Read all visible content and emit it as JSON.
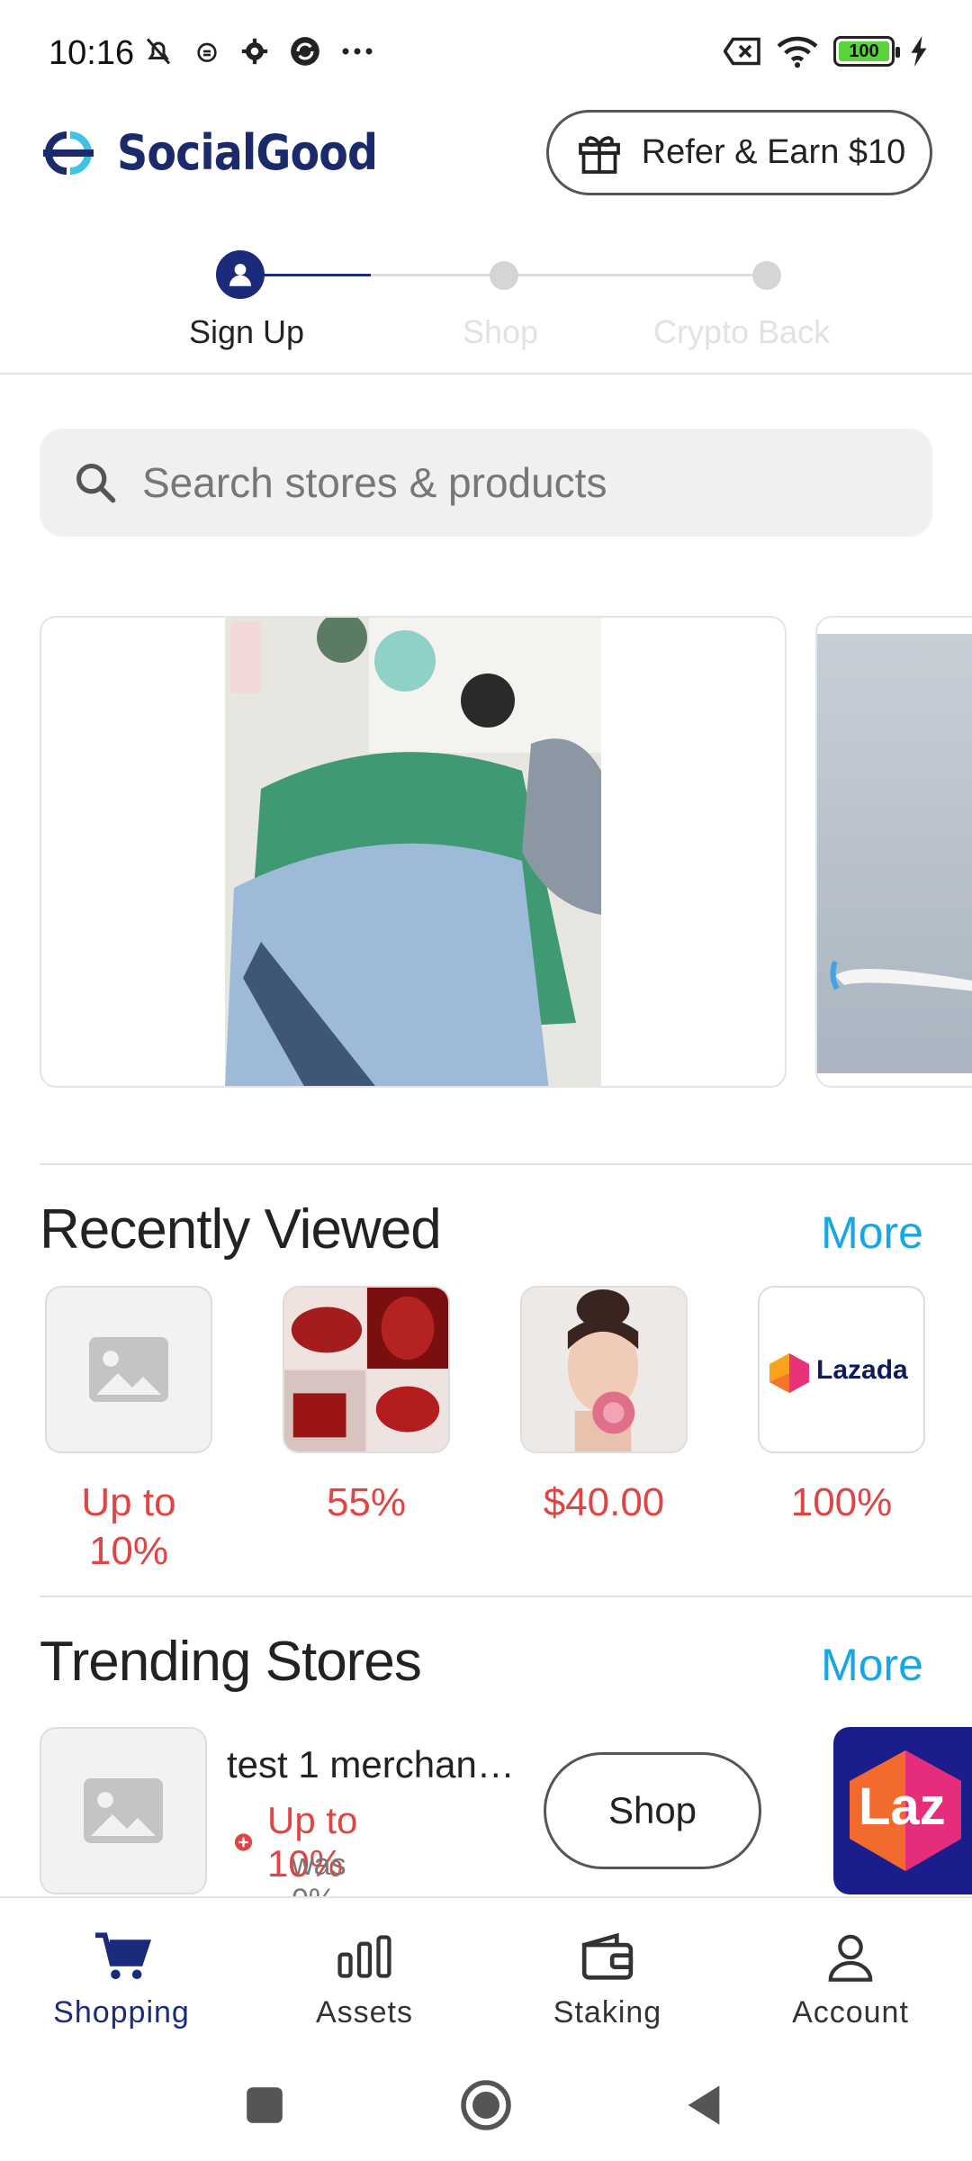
{
  "status_bar": {
    "time": "10:16",
    "battery": "100",
    "icons": [
      "bell-off-icon",
      "alarm-icon",
      "gear-icon",
      "sync-icon",
      "more-icon",
      "sim-off-icon",
      "wifi-icon",
      "battery-icon",
      "charging-icon"
    ]
  },
  "header": {
    "brand": "SocialGood",
    "refer_label": "Refer & Earn $10"
  },
  "stepper": {
    "steps": [
      {
        "label": "Sign Up",
        "active": true
      },
      {
        "label": "Shop",
        "active": false
      },
      {
        "label": "Crypto Back",
        "active": false
      }
    ]
  },
  "search": {
    "placeholder": "Search stores & products",
    "value": ""
  },
  "recently_viewed": {
    "title": "Recently Viewed",
    "more_label": "More",
    "items": [
      {
        "value": "Up to 10%",
        "image": "placeholder-image"
      },
      {
        "value": "55%",
        "image": "lipstick-swatch-photo"
      },
      {
        "value": "$40.00",
        "image": "woman-with-flower-photo"
      },
      {
        "value": "100%",
        "image": "lazada-logo",
        "logo_text": "Lazada"
      }
    ]
  },
  "trending_stores": {
    "title": "Trending Stores",
    "more_label": "More",
    "stores": [
      {
        "name": "test 1 merchan…",
        "cashback": "Up to 10%",
        "was": "was 0%",
        "shop_label": "Shop"
      }
    ],
    "next_logo_text": "Laz"
  },
  "bottom_nav": {
    "items": [
      {
        "label": "Shopping",
        "icon": "cart-icon",
        "active": true
      },
      {
        "label": "Assets",
        "icon": "bars-icon",
        "active": false
      },
      {
        "label": "Staking",
        "icon": "wallet-icon",
        "active": false
      },
      {
        "label": "Account",
        "icon": "person-icon",
        "active": false
      }
    ]
  },
  "colors": {
    "brand_navy": "#1b2a7b",
    "accent_blue": "#17a7e6",
    "cashback_red": "#e04545",
    "battery_green": "#5bd33b"
  }
}
